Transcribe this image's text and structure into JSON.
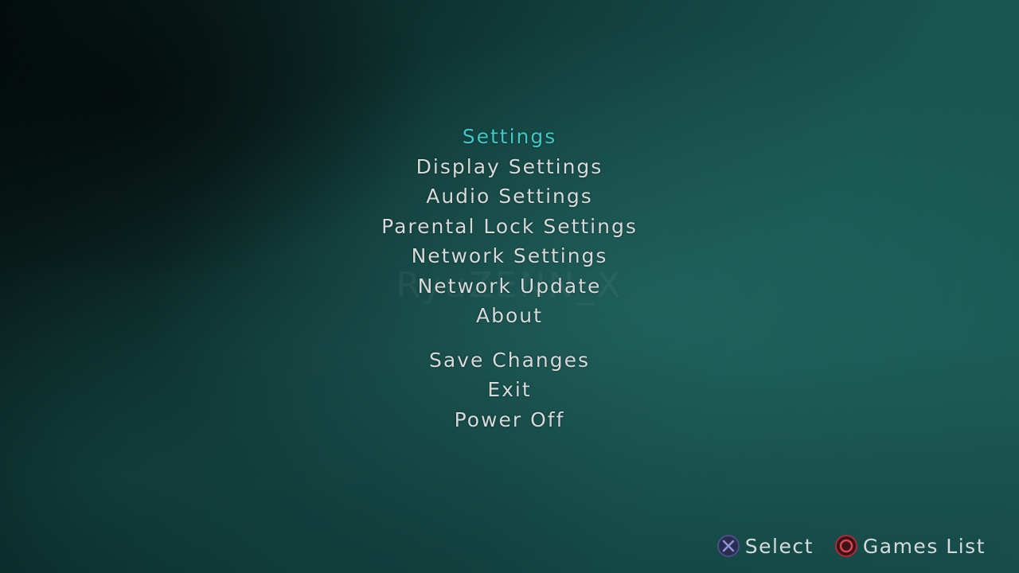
{
  "watermark": "RyuZENN_X",
  "menu": {
    "title": "Settings",
    "items": [
      {
        "label": "Display Settings"
      },
      {
        "label": "Audio Settings"
      },
      {
        "label": "Parental Lock Settings"
      },
      {
        "label": "Network Settings"
      },
      {
        "label": "Network Update"
      },
      {
        "label": "About"
      }
    ],
    "actions": [
      {
        "label": "Save Changes"
      },
      {
        "label": "Exit"
      },
      {
        "label": "Power Off"
      }
    ]
  },
  "footer": {
    "select": {
      "icon": "cross-button-icon",
      "label": "Select"
    },
    "back": {
      "icon": "circle-button-icon",
      "label": "Games List"
    }
  },
  "colors": {
    "title": "#3fc9c9",
    "text": "#d6dadb",
    "cross_icon": "#4a4f8a",
    "circle_icon": "#b02a35"
  }
}
